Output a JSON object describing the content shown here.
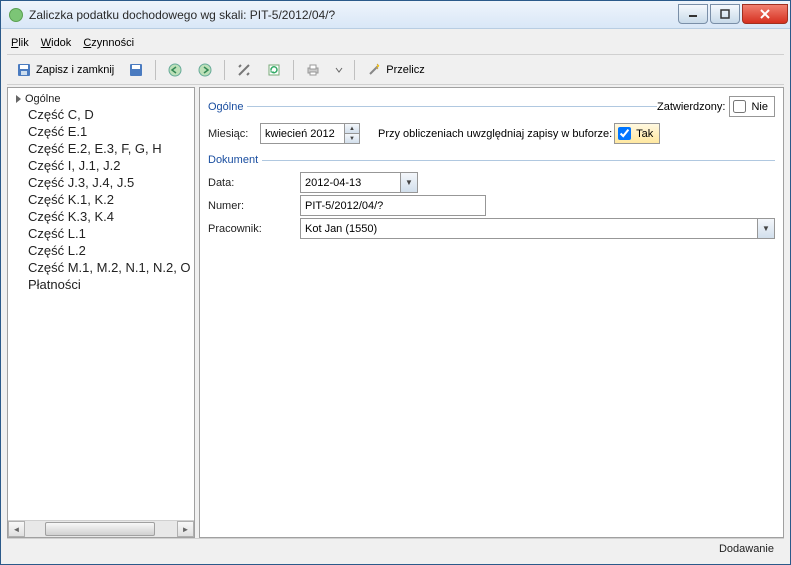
{
  "window": {
    "title": "Zaliczka podatku dochodowego wg skali: PIT-5/2012/04/?"
  },
  "menubar": {
    "file": "Plik",
    "view": "Widok",
    "actions": "Czynności"
  },
  "toolbar": {
    "save_close": "Zapisz i zamknij",
    "recalculate": "Przelicz"
  },
  "nav": {
    "root": "Ogólne",
    "items": [
      "Część C, D",
      "Część E.1",
      "Część E.2, E.3, F, G, H",
      "Część I, J.1, J.2",
      "Część J.3, J.4, J.5",
      "Część K.1, K.2",
      "Część K.3, K.4",
      "Część L.1",
      "Część L.2",
      "Część M.1, M.2, N.1, N.2, O",
      "Płatności"
    ]
  },
  "panel": {
    "group_general": "Ogólne",
    "approved_label": "Zatwierdzony:",
    "approved_value": "Nie",
    "approved_checked": false,
    "month_label": "Miesiąc:",
    "month_value": "kwiecień 2012",
    "buffer_label": "Przy obliczeniach uwzględniaj zapisy w buforze:",
    "buffer_value": "Tak",
    "buffer_checked": true,
    "group_document": "Dokument",
    "date_label": "Data:",
    "date_value": "2012-04-13",
    "number_label": "Numer:",
    "number_value": "PIT-5/2012/04/?",
    "employee_label": "Pracownik:",
    "employee_value": "Kot Jan (1550)"
  },
  "status": {
    "text": "Dodawanie"
  },
  "colors": {
    "link": "#1a4ea0"
  }
}
